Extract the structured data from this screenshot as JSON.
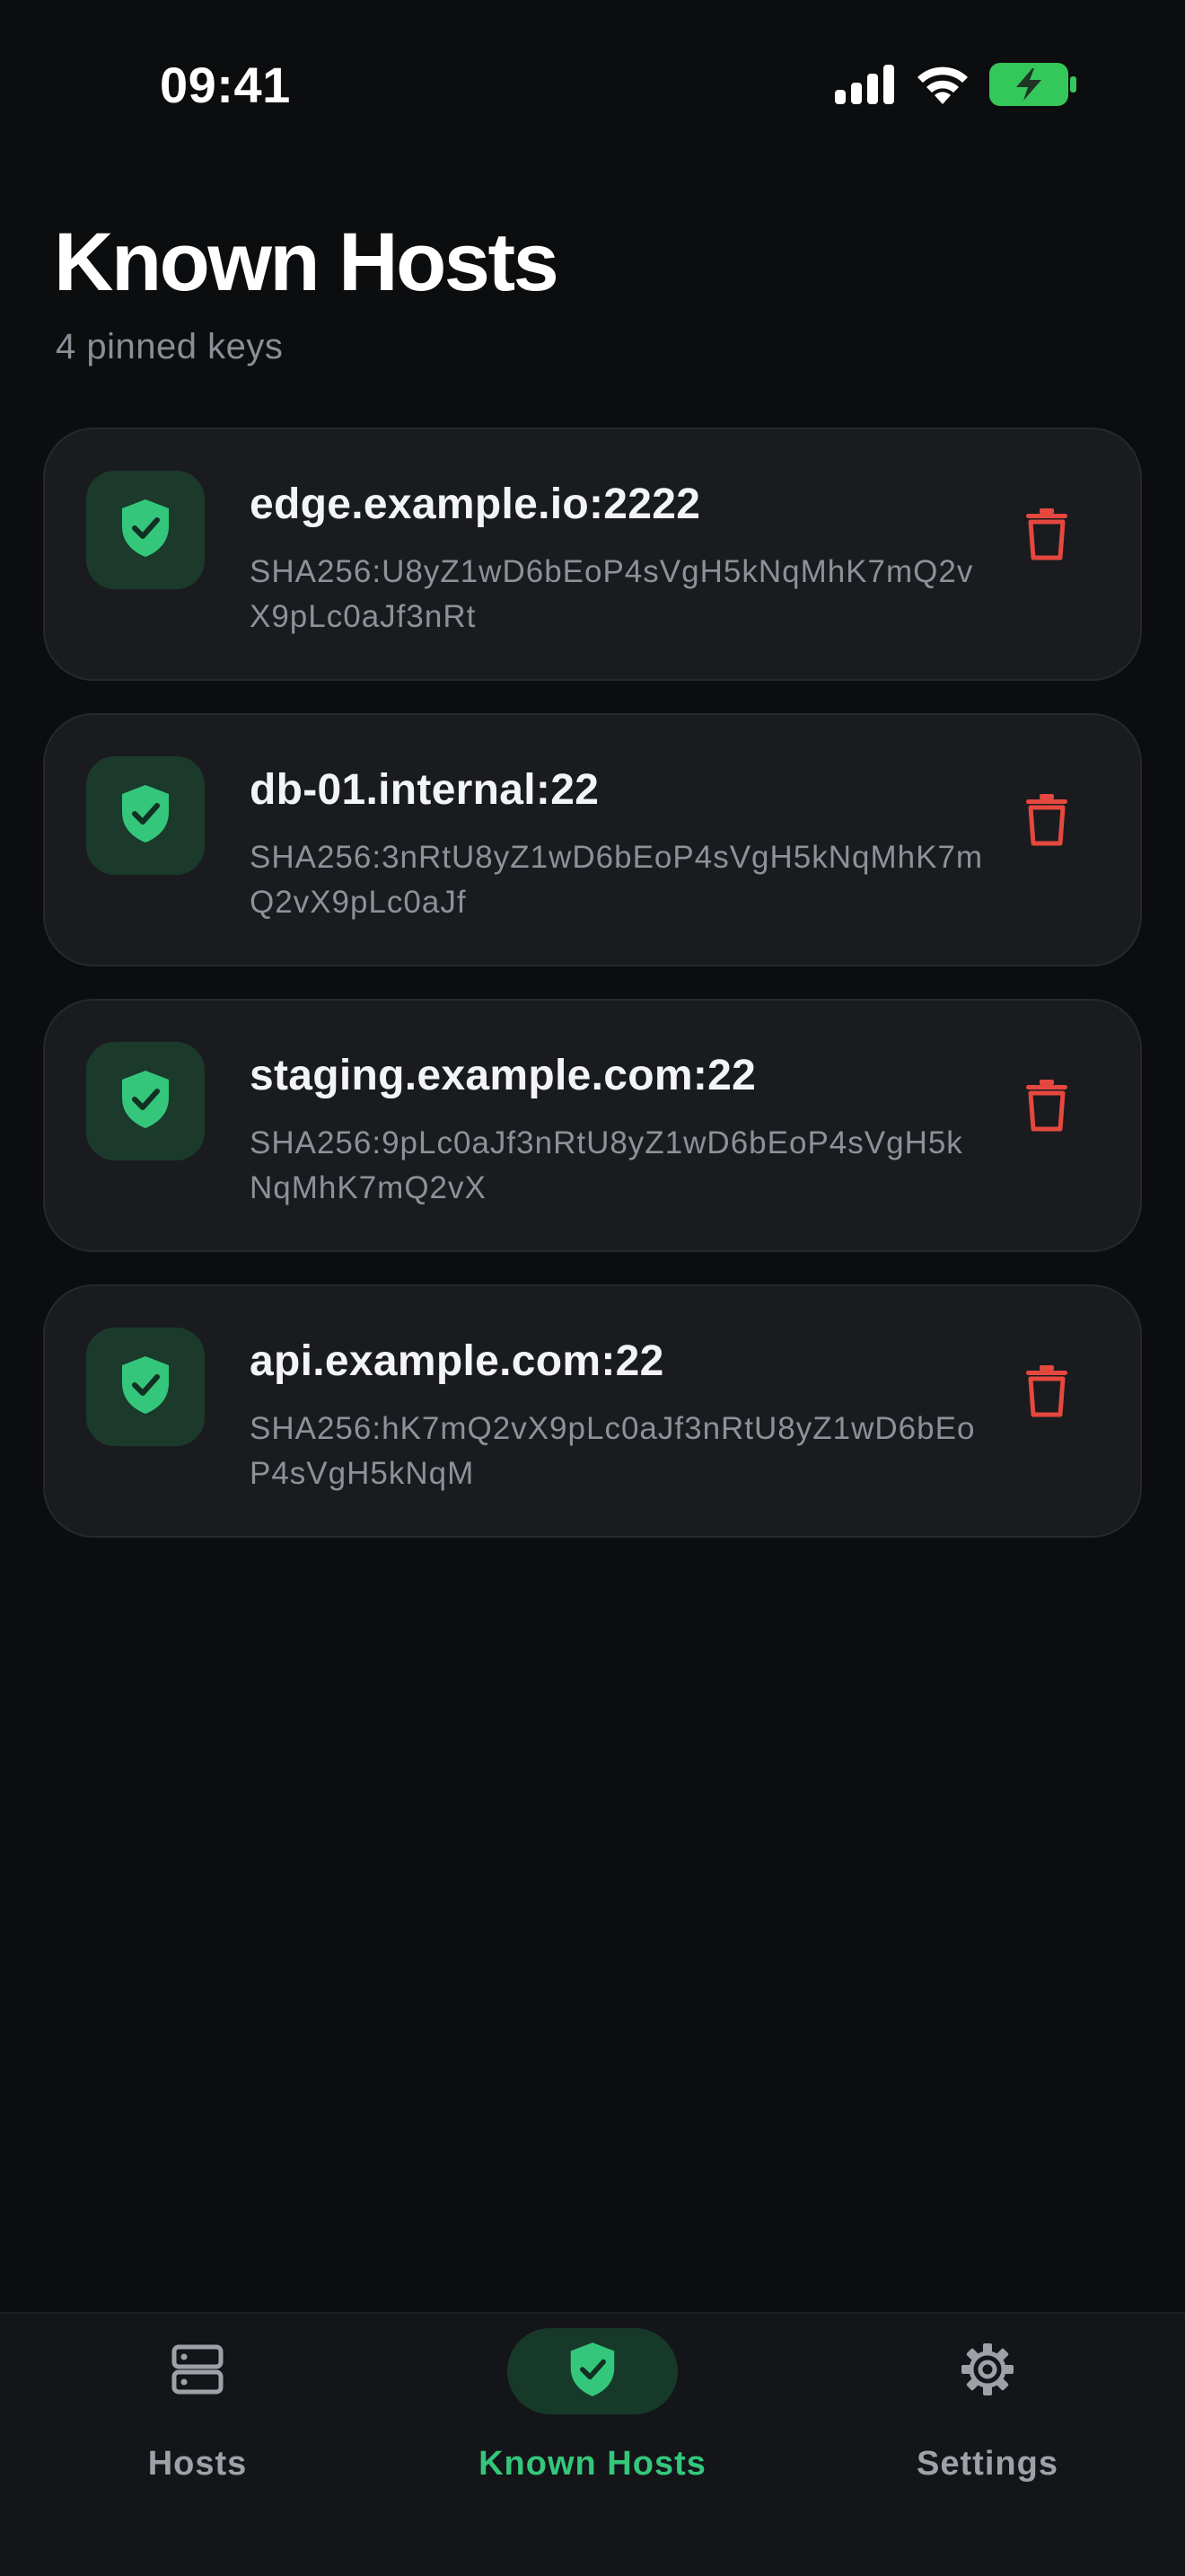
{
  "status_bar": {
    "time": "09:41",
    "icons": [
      "cellular-signal-icon",
      "wifi-icon",
      "battery-charging-icon"
    ]
  },
  "header": {
    "title": "Known Hosts",
    "subtitle": "4 pinned keys"
  },
  "hosts": [
    {
      "name": "edge.example.io:2222",
      "fingerprint": "SHA256:U8yZ1wD6bEoP4sVgH5kNqMhK7mQ2vX9pLc0aJf3nRt"
    },
    {
      "name": "db-01.internal:22",
      "fingerprint": "SHA256:3nRtU8yZ1wD6bEoP4sVgH5kNqMhK7mQ2vX9pLc0aJf"
    },
    {
      "name": "staging.example.com:22",
      "fingerprint": "SHA256:9pLc0aJf3nRtU8yZ1wD6bEoP4sVgH5kNqMhK7mQ2vX"
    },
    {
      "name": "api.example.com:22",
      "fingerprint": "SHA256:hK7mQ2vX9pLc0aJf3nRtU8yZ1wD6bEoP4sVgH5kNqM"
    }
  ],
  "tab_bar": {
    "tabs": [
      {
        "label": "Hosts",
        "icon": "server-icon",
        "active": false
      },
      {
        "label": "Known Hosts",
        "icon": "shield-check-icon",
        "active": true
      },
      {
        "label": "Settings",
        "icon": "gear-icon",
        "active": false
      }
    ]
  },
  "colors": {
    "background": "#0c0d0f",
    "card": "#1a1b1f",
    "accent_green": "#34c77b",
    "badge_green_bg": "#1b3a2b",
    "delete_red": "#e5483e",
    "muted_text": "#8e9199"
  }
}
